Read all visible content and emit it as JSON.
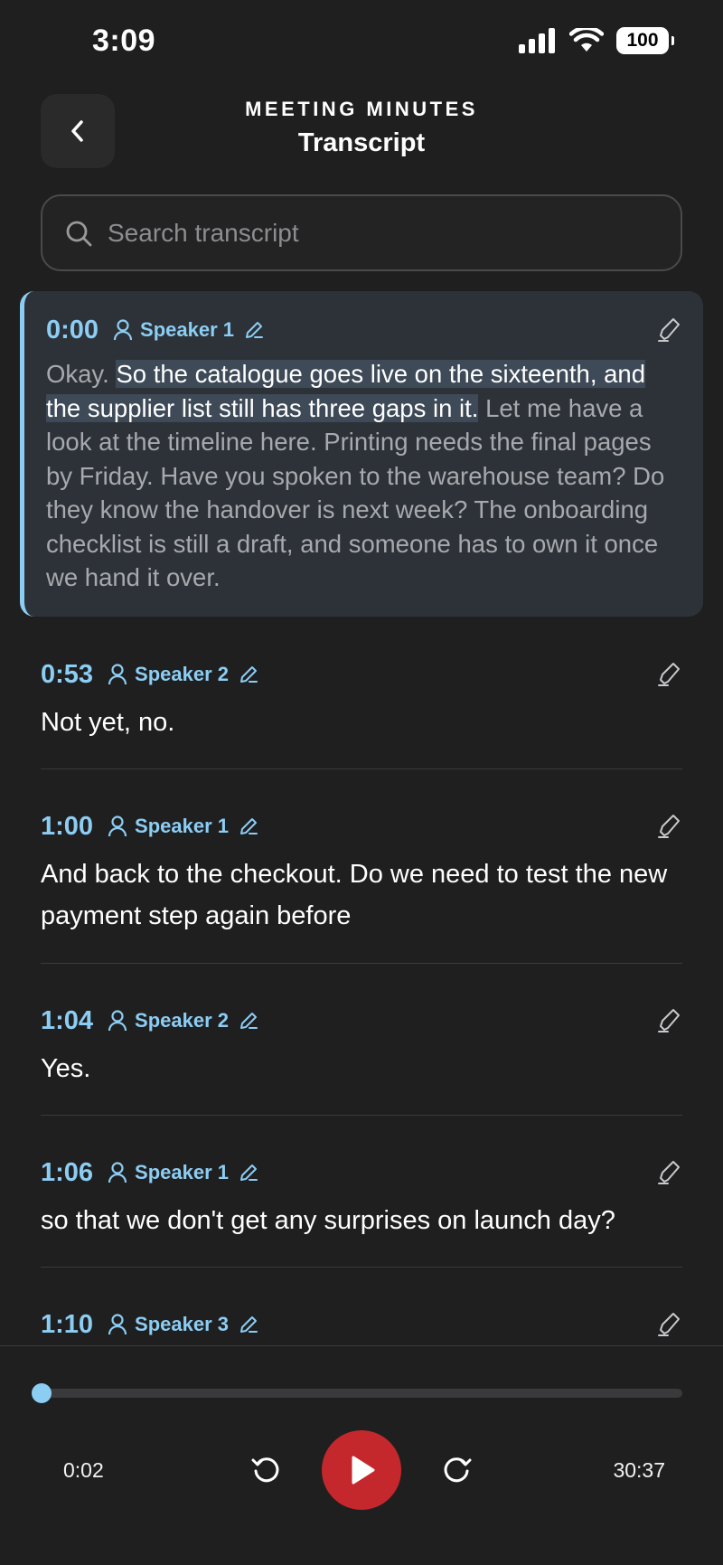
{
  "status": {
    "time": "3:09",
    "battery": "100"
  },
  "header": {
    "subtitle": "MEETING MINUTES",
    "title": "Transcript"
  },
  "search": {
    "placeholder": "Search transcript"
  },
  "segments": [
    {
      "time": "0:00",
      "speaker": "Speaker 1",
      "text_before": "Okay. ",
      "text_highlight": "So the catalogue goes live on the sixteenth, and the supplier list still has three gaps in it.",
      "text_after": " Let me have a look at the timeline here. Printing needs the final pages by Friday. Have you spoken to the warehouse team? Do they know the handover is next week? The onboarding checklist is still a draft, and someone has to own it once we hand it over."
    },
    {
      "time": "0:53",
      "speaker": "Speaker 2",
      "text": "Not yet, no."
    },
    {
      "time": "1:00",
      "speaker": "Speaker 1",
      "text": "And back to the checkout. Do we need to test the new payment step again before"
    },
    {
      "time": "1:04",
      "speaker": "Speaker 2",
      "text": "Yes."
    },
    {
      "time": "1:06",
      "speaker": "Speaker 1",
      "text": "so that we don't get any surprises on launch day?"
    },
    {
      "time": "1:10",
      "speaker": "Speaker 3",
      "text": ""
    }
  ],
  "player": {
    "current": "0:02",
    "total": "30:37",
    "progress": 0.001
  },
  "colors": {
    "accent": "#8ccdf3",
    "play": "#c4282c",
    "background": "#1f1f20"
  },
  "icons": {
    "back": "chevron-left-icon",
    "search": "search-icon",
    "speaker": "person-icon",
    "edit": "pencil-icon",
    "highlight": "highlighter-icon",
    "rewind": "rewind-icon",
    "forward": "forward-icon",
    "play": "play-icon"
  }
}
